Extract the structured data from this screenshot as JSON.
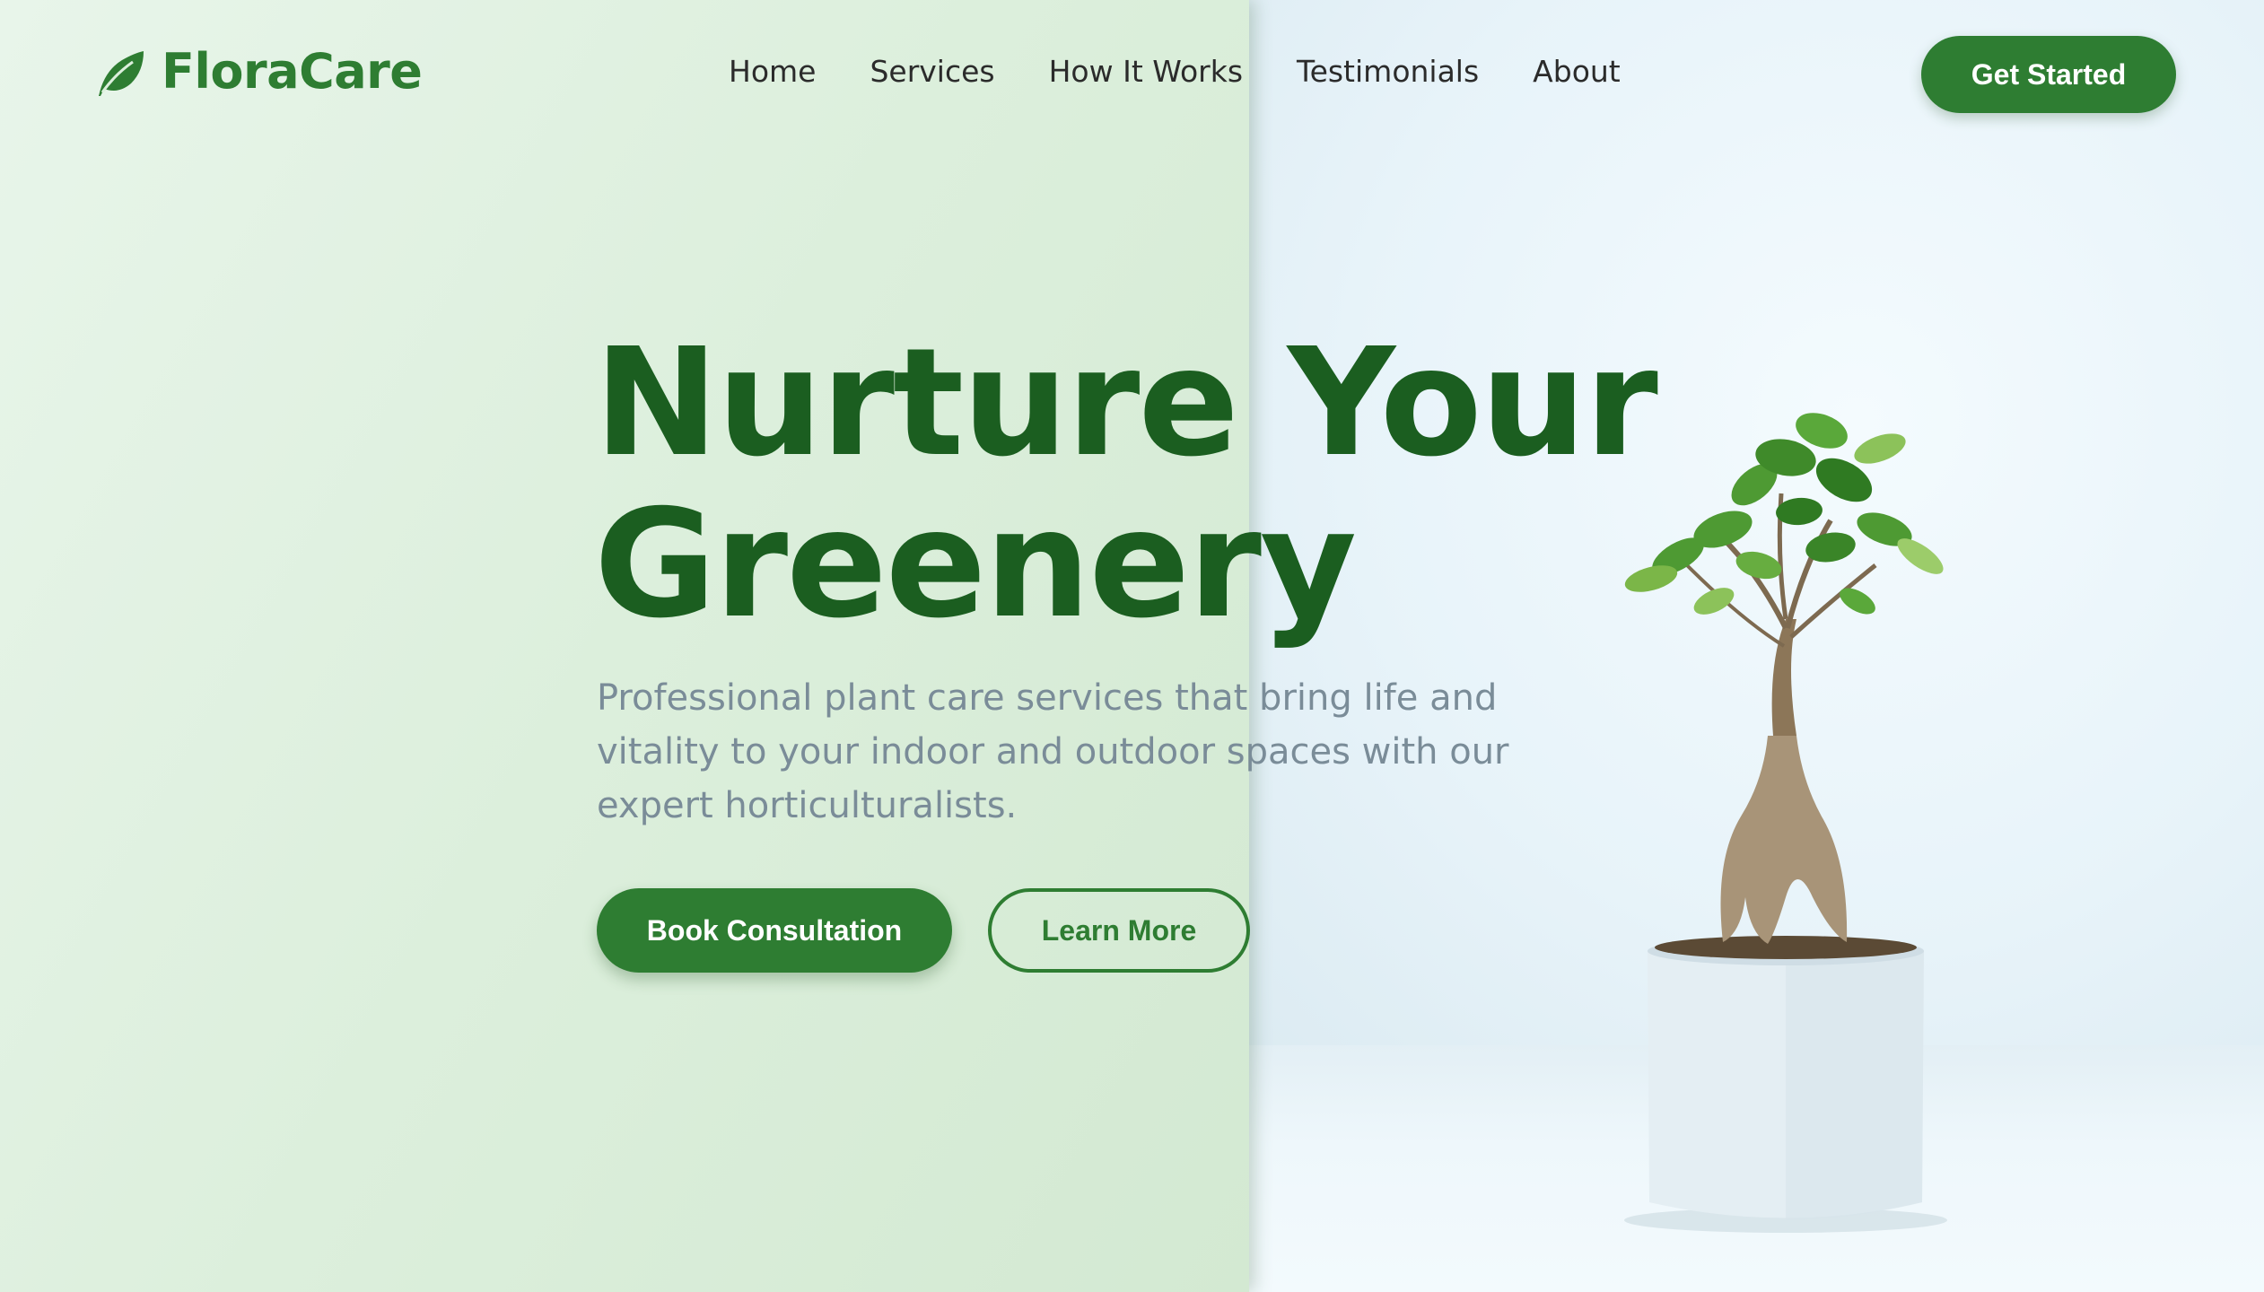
{
  "brand": {
    "name": "FloraCare",
    "icon": "leaf-icon",
    "color": "#2e7d32"
  },
  "nav": {
    "items": [
      {
        "label": "Home"
      },
      {
        "label": "Services"
      },
      {
        "label": "How It Works"
      },
      {
        "label": "Testimonials"
      },
      {
        "label": "About"
      }
    ],
    "cta_label": "Get Started"
  },
  "hero": {
    "title_line1": "Nurture Your",
    "title_line2": "Greenery",
    "subtitle": "Professional plant care services that bring life and vitality to your indoor and outdoor spaces with our expert horticulturalists.",
    "primary_button": "Book Consultation",
    "secondary_button": "Learn More"
  },
  "colors": {
    "accent": "#2e7d32",
    "title": "#1b5e20",
    "subtitle": "#7a8c98",
    "overlay": "#dcefdc"
  },
  "image": {
    "icon": "bonsai-plant-image"
  }
}
